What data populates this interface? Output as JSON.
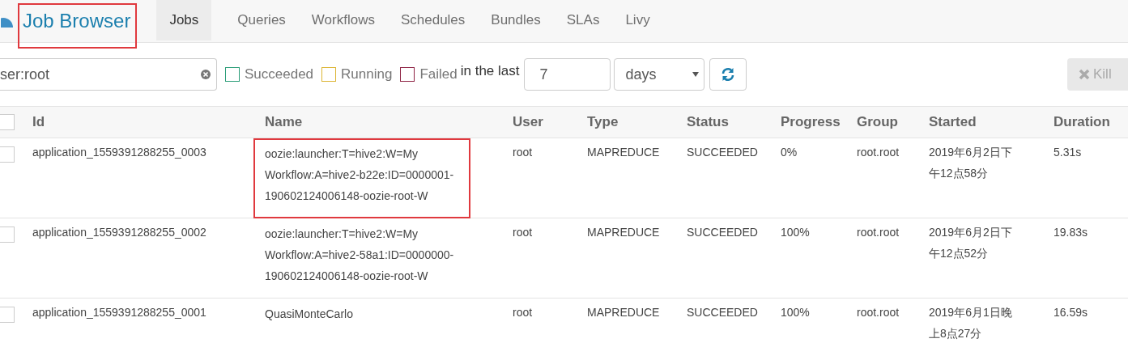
{
  "header": {
    "title": "Job Browser",
    "title_highlighted": true,
    "tabs": [
      {
        "label": "Jobs",
        "selected": true
      },
      {
        "label": "Queries",
        "selected": false
      },
      {
        "label": "Workflows",
        "selected": false
      },
      {
        "label": "Schedules",
        "selected": false
      },
      {
        "label": "Bundles",
        "selected": false
      },
      {
        "label": "SLAs",
        "selected": false
      },
      {
        "label": "Livy",
        "selected": false
      }
    ]
  },
  "filters": {
    "search": {
      "value": "ser:root"
    },
    "statuses": [
      {
        "label": "Succeeded",
        "checked": false,
        "color": "#2a9d78"
      },
      {
        "label": "Running",
        "checked": false,
        "color": "#dcb534"
      },
      {
        "label": "Failed",
        "checked": false,
        "color": "#8e2344"
      }
    ],
    "time_label": "in the last",
    "time_value": "7",
    "time_unit": "days",
    "kill_button": {
      "label": "Kill",
      "disabled": true
    }
  },
  "table": {
    "all_checked": false,
    "columns": [
      "Id",
      "Name",
      "User",
      "Type",
      "Status",
      "Progress",
      "Group",
      "Started",
      "Duration"
    ],
    "rows": [
      {
        "checked": false,
        "name_highlighted": true,
        "cells": [
          "application_1559391288255_0003",
          "oozie:launcher:T=hive2:W=My Workflow:A=hive2-b22e:ID=0000001-190602124006148-oozie-root-W",
          "root",
          "MAPREDUCE",
          "SUCCEEDED",
          "0%",
          "root.root",
          "2019年6月2日下午12点58分",
          "5.31s"
        ]
      },
      {
        "checked": false,
        "name_highlighted": false,
        "cells": [
          "application_1559391288255_0002",
          "oozie:launcher:T=hive2:W=My Workflow:A=hive2-58a1:ID=0000000-190602124006148-oozie-root-W",
          "root",
          "MAPREDUCE",
          "SUCCEEDED",
          "100%",
          "root.root",
          "2019年6月2日下午12点52分",
          "19.83s"
        ]
      },
      {
        "checked": false,
        "name_highlighted": false,
        "cells": [
          "application_1559391288255_0001",
          "QuasiMonteCarlo",
          "root",
          "MAPREDUCE",
          "SUCCEEDED",
          "100%",
          "root.root",
          "2019年6月1日晚上8点27分",
          "16.59s"
        ]
      }
    ]
  }
}
